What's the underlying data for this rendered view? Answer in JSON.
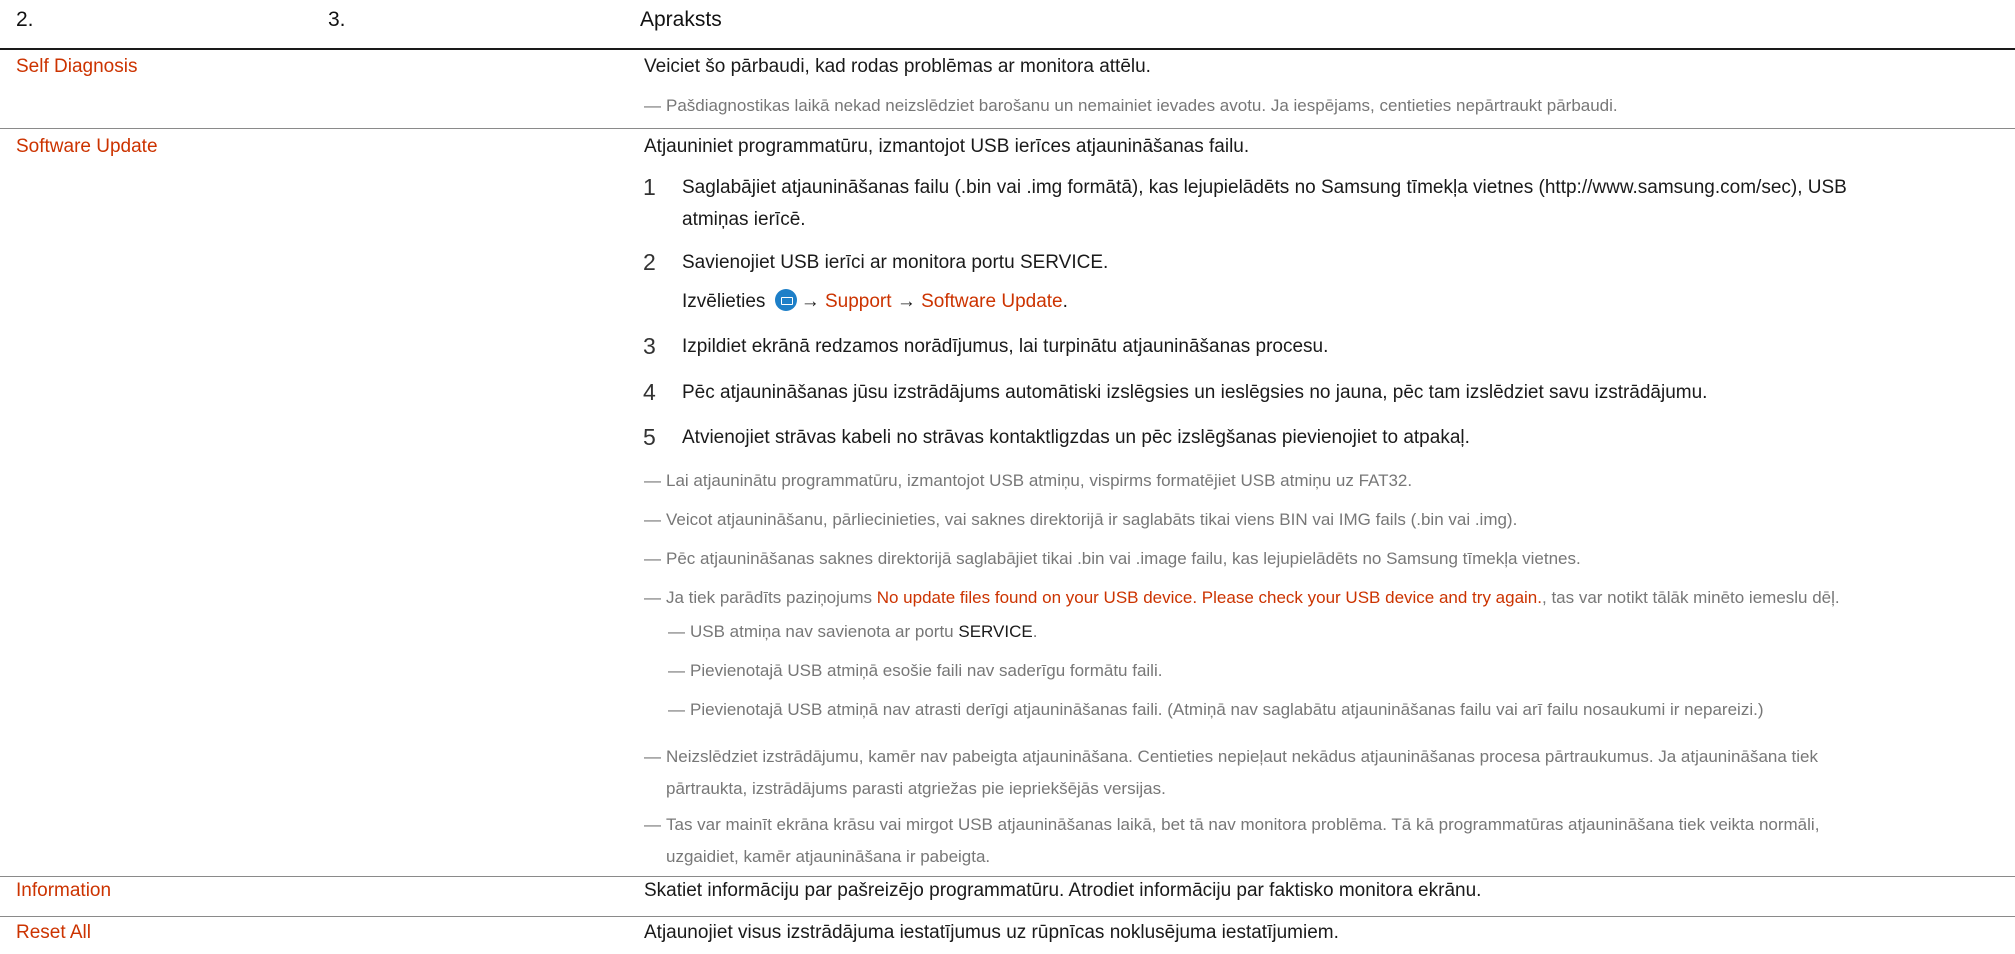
{
  "header": {
    "col1": "2.",
    "col2": "3.",
    "col3": "Apraksts"
  },
  "self_diagnosis": {
    "label": "Self Diagnosis",
    "description": "Veiciet šo pārbaudi, kad rodas problēmas ar monitora attēlu.",
    "note": "Pašdiagnostikas laikā nekad neizslēdziet barošanu un nemainiet ievades avotu. Ja iespējams, centieties nepārtraukt pārbaudi."
  },
  "software_update": {
    "label": "Software Update",
    "description": "Atjauniniet programmatūru, izmantojot USB ierīces atjaunināšanas failu.",
    "steps": [
      {
        "num": "1",
        "line1": "Saglabājiet atjaunināšanas failu (.bin vai .img formātā), kas lejupielādēts no Samsung tīmekļa vietnes (http://www.samsung.com/sec), USB",
        "line2": "atmiņas ierīcē."
      },
      {
        "num": "2",
        "text": "Savienojiet USB ierīci ar monitora portu ",
        "port": "SERVICE",
        "end": ".",
        "sub_prefix": "Izvēlieties",
        "arrow1": "→",
        "support": "Support",
        "arrow2": "→",
        "software_update": "Software Update",
        "sub_end": "."
      },
      {
        "num": "3",
        "text": "Izpildiet ekrānā redzamos norādījumus, lai turpinātu atjaunināšanas procesu."
      },
      {
        "num": "4",
        "text": "Pēc atjaunināšanas jūsu izstrādājums automātiski izslēgsies un ieslēgsies no jauna, pēc tam izslēdziet savu izstrādājumu."
      },
      {
        "num": "5",
        "text": "Atvienojiet strāvas kabeli no strāvas kontaktligzdas un pēc izslēgšanas pievienojiet to atpakaļ."
      }
    ],
    "notes": {
      "n1": "Lai atjauninātu programmatūru, izmantojot USB atmiņu, vispirms formatējiet USB atmiņu uz FAT32.",
      "n2": "Veicot atjaunināšanu, pārliecinieties, vai saknes direktorijā ir saglabāts tikai viens BIN vai IMG fails (.bin vai .img).",
      "n3": "Pēc atjaunināšanas saknes direktorijā saglabājiet tikai .bin vai .image failu, kas lejupielādēts no Samsung tīmekļa vietnes.",
      "n4_prefix": "Ja tiek parādīts paziņojums ",
      "n4_message": "No update files found on your USB device. Please check your USB device and try again.",
      "n4_suffix": ", tas var notikt tālāk minēto iemeslu dēļ.",
      "sub1_prefix": "USB atmiņa nav savienota ar portu ",
      "sub1_port": "SERVICE",
      "sub1_end": ".",
      "sub2": "Pievienotajā USB atmiņā esošie faili nav saderīgu formātu faili.",
      "sub3": "Pievienotajā USB atmiņā nav atrasti derīgi atjaunināšanas faili. (Atmiņā nav saglabātu atjaunināšanas failu vai arī failu nosaukumi ir nepareizi.)",
      "n5_line1": "Neizslēdziet izstrādājumu, kamēr nav pabeigta atjaunināšana. Centieties nepieļaut nekādus atjaunināšanas procesa pārtraukumus. Ja atjaunināšana tiek",
      "n5_line2": "pārtraukta, izstrādājums parasti atgriežas pie iepriekšējās versijas.",
      "n6_line1": "Tas var mainīt ekrāna krāsu vai mirgot USB atjaunināšanas laikā, bet tā nav monitora problēma. Tā kā programmatūras atjaunināšana tiek veikta normāli,",
      "n6_line2": "uzgaidiet, kamēr atjaunināšana ir pabeigta."
    }
  },
  "information": {
    "label": "Information",
    "description": "Skatiet informāciju par pašreizējo programmatūru. Atrodiet informāciju par faktisko monitora ekrānu."
  },
  "reset_all": {
    "label": "Reset All",
    "description": "Atjaunojiet visus izstrādājuma iestatījumus uz rūpnīcas noklusējuma iestatījumiem."
  },
  "note_mark": "―",
  "colors": {
    "accent": "#cc3300",
    "note": "#777777",
    "icon_blue": "#1d7fc8"
  },
  "icons": {
    "menu": "menu-icon"
  }
}
